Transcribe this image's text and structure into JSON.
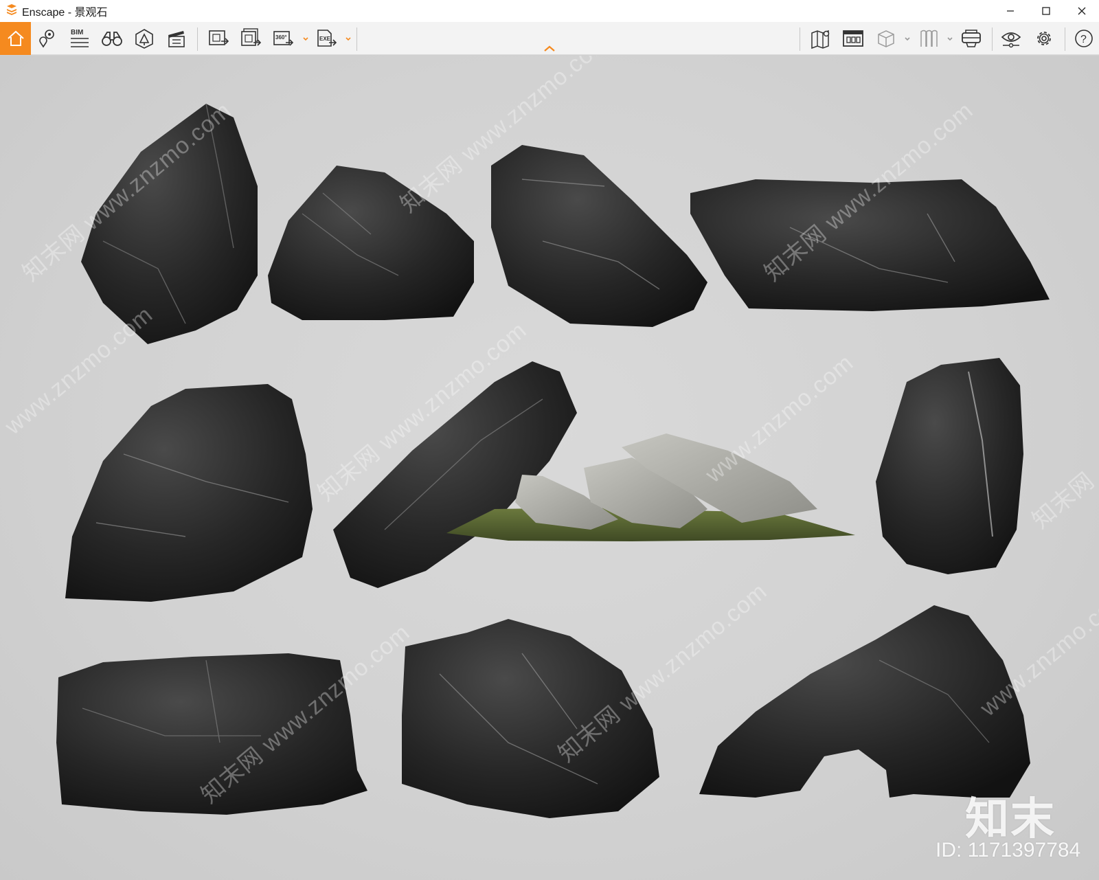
{
  "window": {
    "app_name": "Enscape",
    "separator": " - ",
    "project_name": "景观石",
    "accent_color": "#f58a1f"
  },
  "toolbar": {
    "left_buttons": [
      {
        "id": "home",
        "icon": "home-icon"
      },
      {
        "id": "views",
        "icon": "map-pin-views-icon"
      },
      {
        "id": "bim",
        "icon": "bim-info-icon",
        "label": "BIM"
      },
      {
        "id": "binoculars",
        "icon": "binoculars-icon"
      },
      {
        "id": "asset-library",
        "icon": "asset-library-icon"
      },
      {
        "id": "video-editor",
        "icon": "clapperboard-icon"
      },
      {
        "id": "render-image",
        "icon": "render-image-icon"
      },
      {
        "id": "batch-render",
        "icon": "batch-render-icon"
      },
      {
        "id": "render-360",
        "icon": "panorama-360-icon",
        "label": "360°"
      },
      {
        "id": "export-exe",
        "icon": "export-exe-icon",
        "label": "EXE"
      }
    ],
    "right_buttons": [
      {
        "id": "map",
        "icon": "map-icon"
      },
      {
        "id": "dashboard",
        "icon": "dashboard-icon"
      },
      {
        "id": "cube",
        "icon": "cube-icon"
      },
      {
        "id": "vr-alt",
        "icon": "bookmarks-icon"
      },
      {
        "id": "vr-headset",
        "icon": "vr-headset-icon"
      },
      {
        "id": "visual-settings",
        "icon": "eye-icon"
      },
      {
        "id": "settings",
        "icon": "gear-icon"
      },
      {
        "id": "help",
        "icon": "help-icon"
      }
    ]
  },
  "watermarks": {
    "site": "www.znzmo.com",
    "brand": "知末网",
    "logo": "知末",
    "id_text": "ID: 1171397784"
  }
}
